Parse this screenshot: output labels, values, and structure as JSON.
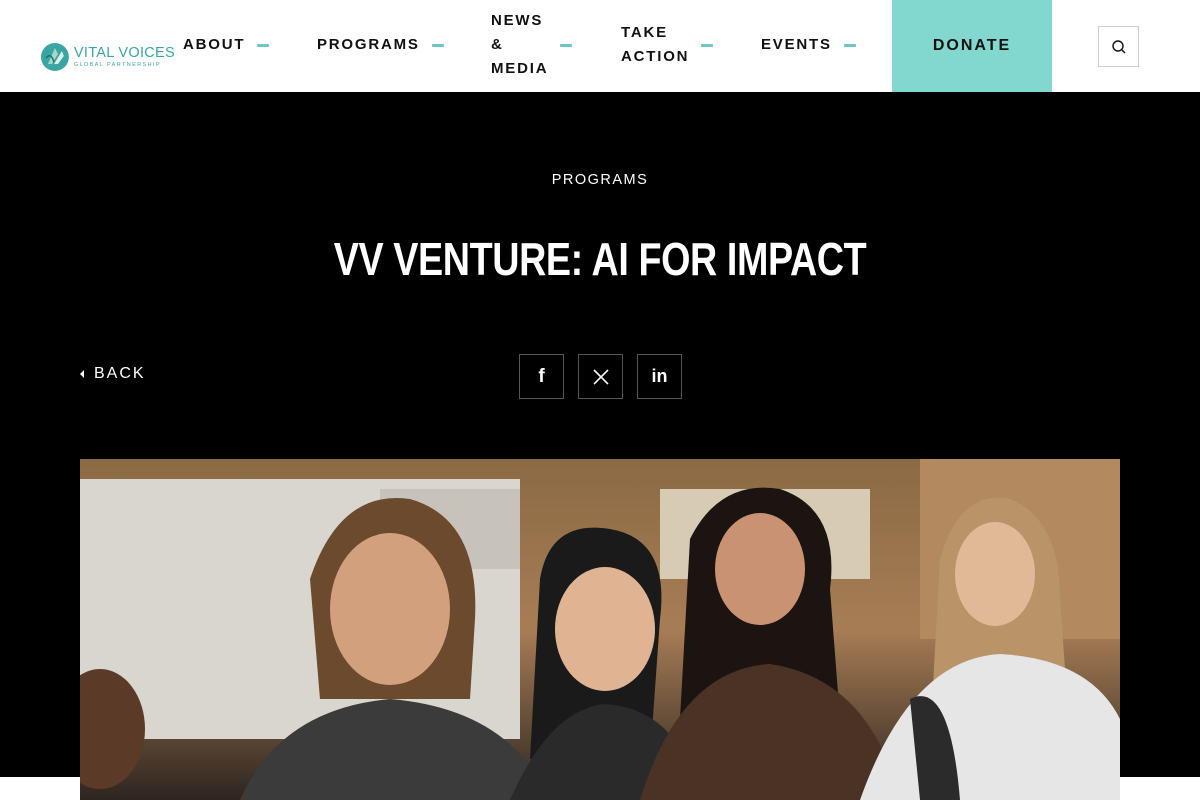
{
  "header": {
    "logo": {
      "name": "VITAL VOICES",
      "tagline": "GLOBAL PARTNERSHIP"
    },
    "nav": [
      {
        "label": "ABOUT"
      },
      {
        "label": "PROGRAMS"
      },
      {
        "label_lines": [
          "NEWS",
          "&",
          "MEDIA"
        ]
      },
      {
        "label_lines": [
          "TAKE",
          "ACTION"
        ]
      },
      {
        "label": "EVENTS"
      }
    ],
    "donate_label": "DONATE",
    "search_icon": "search-icon",
    "accent_color": "#82d7cf",
    "caret_color": "#6cc7c2"
  },
  "hero": {
    "eyebrow": "PROGRAMS",
    "title": "VV VENTURE: AI FOR IMPACT",
    "back_label": "BACK",
    "share": [
      {
        "network": "facebook",
        "glyph": "f",
        "icon": "facebook-icon"
      },
      {
        "network": "x",
        "glyph": "𝕏",
        "icon": "x-twitter-icon"
      },
      {
        "network": "linkedin",
        "glyph": "in",
        "icon": "linkedin-icon"
      }
    ]
  }
}
